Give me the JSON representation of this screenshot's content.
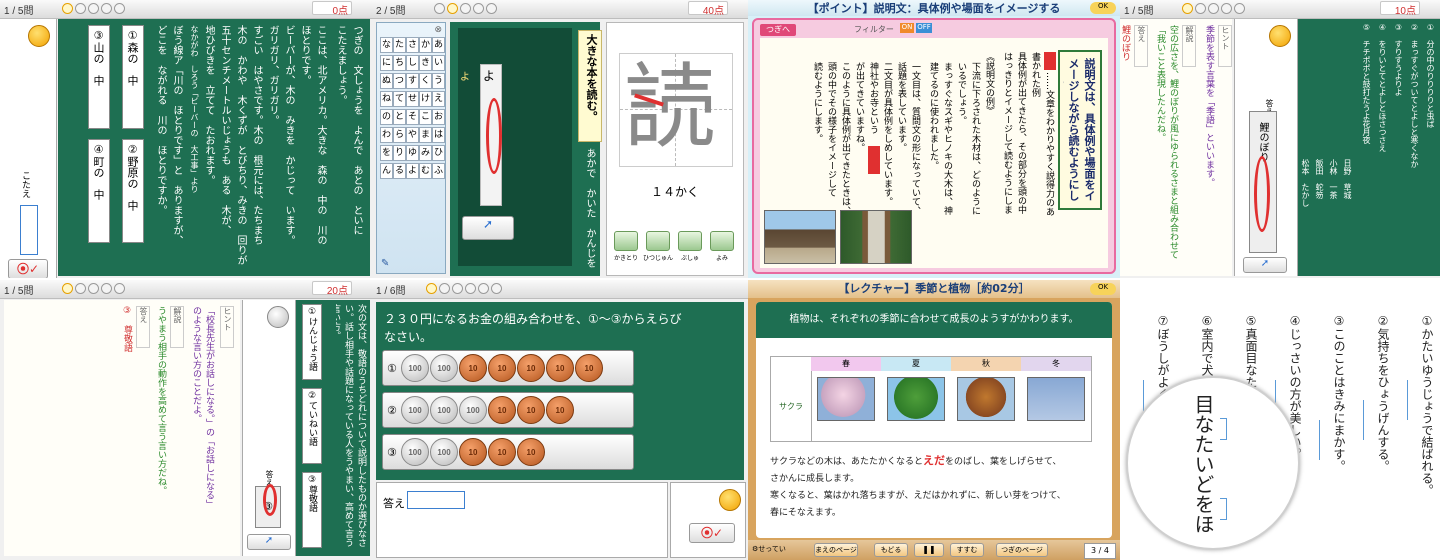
{
  "p1": {
    "pager": "1 / 5",
    "unit": "問",
    "score": "0点",
    "answer_label": "こたえ",
    "cols": [
      "つぎの　文しょうを　よんで　あとの　といに",
      "こたえましょう。",
      "ここは、北アメリカ。大きな　森の　中の　川の",
      "ほとりです。",
      "ビーバーが、木の　みきを　かじって　います。",
      "ガリガリ、ガリガリ。",
      "すごい　はやさです。木の　根元には、たちまち",
      "木の　かわや　木くずが　とびちり、みきの　回りが",
      "五十センチメートルいじょうも　ある　木が、",
      "地ひびきを　立てて　たおれます。",
      "なかがわ　しろう「ビーバーの　大工事」より",
      "ぼう線ア「川の　ほとりです」と　ありますが、",
      "どこを　ながれる　川の　ほとりですか。"
    ],
    "options": [
      "①森の　中",
      "②野原の　中",
      "③山の　中",
      "④町の　中"
    ]
  },
  "p2": {
    "pager": "2 / 5",
    "unit": "問",
    "score": "40点",
    "kana_rows": [
      [
        "な",
        "た",
        "さ",
        "か",
        "あ"
      ],
      [
        "に",
        "ち",
        "し",
        "き",
        "い"
      ],
      [
        "ぬ",
        "つ",
        "す",
        "く",
        "う"
      ],
      [
        "ね",
        "て",
        "せ",
        "け",
        "え"
      ],
      [
        "の",
        "と",
        "そ",
        "こ",
        "お"
      ],
      [
        "わ",
        "ら",
        "や",
        "ま",
        "は"
      ],
      [
        "を",
        "り",
        "ゆ",
        "み",
        "ひ"
      ],
      [
        "ん",
        "る",
        "よ",
        "む",
        "ふ"
      ]
    ],
    "kanji": "読",
    "stroke_count": "１４かく",
    "tools": [
      "かきとり",
      "ひつじゅん",
      "ぶしゅ",
      "よみ"
    ],
    "sentence": "大きな本を読む。",
    "input_char": "よ",
    "instruction": "あかで　かいた　かんじを　よみましょう。"
  },
  "p3": {
    "header": "【ポイント】説明文：具体例や場面をイメージする",
    "filter_label": "フィルター",
    "on": "ON",
    "off": "OFF",
    "next_tab": "つぎへ",
    "title": "説明文は、具体例や場面をイメージしながら読むようにします。",
    "body": [
      "……文章をわかりやすく説得力のあるものにするために",
      "書かれた例",
      "具体例が出てきたら、その部分を頭の中で、できるだけ",
      "はっきりとイメージして読むようにします。",
      "《説明文の例》",
      "下流に下ろされた木材は、どのように使われて",
      "いるでしょう。",
      "まっすぐなスギやヒノキの大木は、神社やお寺を",
      "建てるのに使われました。",
      "一文目は、質問文の形になっていて、",
      "話題を表しています。",
      "二文目が具体例をしめしています。",
      "神社やお寺という",
      "が出てきていますね。",
      "このように具体例が出てきたときは、",
      "頭の中でその様子をイメージして",
      "読むようにします。"
    ]
  },
  "p4": {
    "pager": "1 / 5",
    "unit": "問",
    "score": "10点",
    "hint_label": "ヒント",
    "hint_text": "季節を表す言葉を「季語」といいます。",
    "explain_label": "解説",
    "explain_text": "空の広さを、鯉のぼりが風にゆられるさまと組み合わせて「我いこと表現したんだね。",
    "answer_label": "答え",
    "answer_text": "鯉のぼり",
    "answer_small": "鯉のぼり",
    "poems": [
      "①　分の中のりりりりと虫ば",
      "②　まっすぐがついてとよしと寒くなか",
      "③　すりすうよりよ",
      "④　をりいとてとよしとほさつさえ",
      "⑤　チチポポと鼓打たうよ花月夜"
    ],
    "authors": [
      "日野　草城",
      "小林　一茶",
      "飯田　蛇笏",
      "松本　たかし"
    ]
  },
  "p5": {
    "pager": "1 / 5",
    "unit": "問",
    "score": "20点",
    "hint_label": "ヒント",
    "hint_text": "「校長先生がお話しになる。」の「お話しになる」のような言い方のことだよ。",
    "explain_label": "解説",
    "explain_text": "うやまう相手の動作を高めて言う言い方だね。",
    "answer_label": "答え",
    "answer_text": "③　尊敬語",
    "answer_label2": "答え",
    "answer_mark": "③",
    "question": "次の文は、敬語のうちどれについて説明したものか選びなさい。話し相手や話題になっている人をうやまい、高めて言う言い方。",
    "options": [
      "①けんじょう語",
      "②ていねい語",
      "③尊敬語"
    ]
  },
  "p6": {
    "pager": "1 / 6",
    "unit": "問",
    "question": "２３０円になるお金の組み合わせを、①～③からえらびなさい。",
    "rows": [
      {
        "num": "①",
        "coins": [
          "100",
          "100",
          "10",
          "10",
          "10",
          "10",
          "10"
        ]
      },
      {
        "num": "②",
        "coins": [
          "100",
          "100",
          "100",
          "10",
          "10",
          "10"
        ]
      },
      {
        "num": "③",
        "coins": [
          "100",
          "100",
          "10",
          "10",
          "10"
        ]
      }
    ],
    "answer_label": "答え",
    "answer_value": ""
  },
  "p7": {
    "header": "【レクチャー】季節と植物［約02分］",
    "subtitle": "植物は、それぞれの季節に合わせて成長のようすがかわります。",
    "seasons": [
      "春",
      "夏",
      "秋",
      "冬"
    ],
    "plant": "サクラ",
    "text1a": "サクラなどの木は、あたたかくなると",
    "text1b": "えだ",
    "text1c": "をのばし、葉をしげらせて、",
    "text2": "さかんに成長します。",
    "text3": "寒くなると、葉はかれ落ちますが、えだはかれずに、新しい芽をつけて、",
    "text4": "春にそなえます。",
    "controls": [
      "まえのページ",
      "もどる",
      "すすむ",
      "つぎのページ"
    ],
    "settings": "せってい",
    "page": "3 / 4"
  },
  "p8": {
    "items": [
      "①かたいゆうじょうで結ばれる。",
      "②気持ちをひょうげんする。",
      "③このことはきみにまかす。",
      "④じっさいの方が美しい。",
      "⑤真面目なたいどをほめられた。",
      "⑥室内で犬をかう。",
      "⑦ぼうしがよくにあう。"
    ],
    "zoom_text": "目なたいどをほ"
  },
  "colors": {
    "green": "#1e6f52",
    "red": "#e03030",
    "cream": "#fffef8",
    "lecture_brown": "#c08040"
  }
}
